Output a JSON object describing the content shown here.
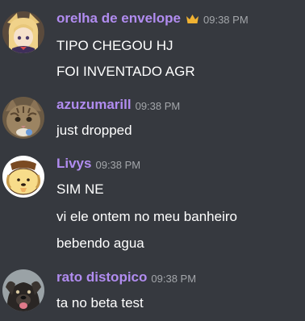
{
  "messages": [
    {
      "username": "orelha de envelope",
      "timestamp": "09:38 PM",
      "avatar": "anime-character-avatar",
      "badge": "crown-icon",
      "lines": [
        "TIPO CHEGOU HJ",
        "FOI INVENTADO AGR"
      ]
    },
    {
      "username": "azuzumarill",
      "timestamp": "09:38 PM",
      "avatar": "cat-avatar",
      "lines": [
        "just dropped"
      ]
    },
    {
      "username": "Livys",
      "timestamp": "09:38 PM",
      "avatar": "pompompurin-avatar",
      "lines": [
        "SIM NE",
        "vi ele ontem no meu banheiro",
        "bebendo agua"
      ]
    },
    {
      "username": "rato distopico",
      "timestamp": "09:38 PM",
      "avatar": "dog-avatar",
      "lines": [
        "ta no beta test"
      ]
    }
  ],
  "colors": {
    "background": "#36393f",
    "username": "#b18cf0",
    "timestamp": "#a3a6aa",
    "message_text": "#ffffff",
    "crown": "#f0b232"
  }
}
